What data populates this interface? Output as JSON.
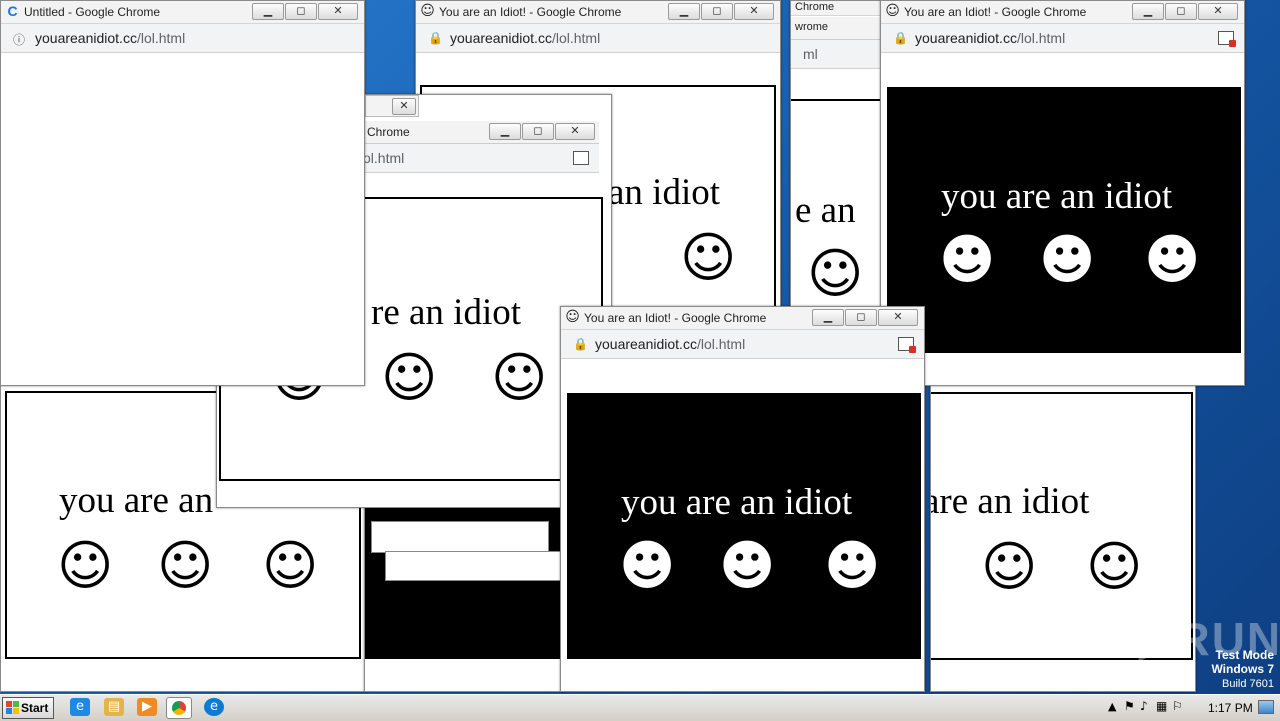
{
  "colors": {
    "desktop": "#1f6fc5",
    "panel_dark": "#000000",
    "panel_light": "#ffffff",
    "titlebar": "#f3f3f3"
  },
  "window_titles": {
    "untitled": "Untitled - Google Chrome",
    "idiot": "You are an Idiot! - Google Chrome",
    "partial": "Chrome",
    "partial_2": "wrome"
  },
  "address": {
    "domain": "youareanidiot.cc",
    "path": "/lol.html",
    "partial": "ol.html",
    "partial_2": "ml"
  },
  "phrases": {
    "full": "you are an idiot",
    "partial_left": "you are an",
    "partial_right": "are an idiot",
    "partial_mid": "an idiot",
    "partial_center": "re an idiot",
    "partial_short": "e an"
  },
  "icons": {
    "smiley_light": "☺",
    "smiley_dark": "☻",
    "minimize": "▁",
    "maximize": "◻",
    "close": "✕",
    "lock": "🔒",
    "info": "ⓘ"
  },
  "taskbar": {
    "start_label": "Start",
    "clock": "1:17 PM"
  },
  "watermark": {
    "line1": "Test Mode",
    "line2": "Windows 7",
    "line3": "Build 7601",
    "brand": "ANY▷RUN"
  }
}
